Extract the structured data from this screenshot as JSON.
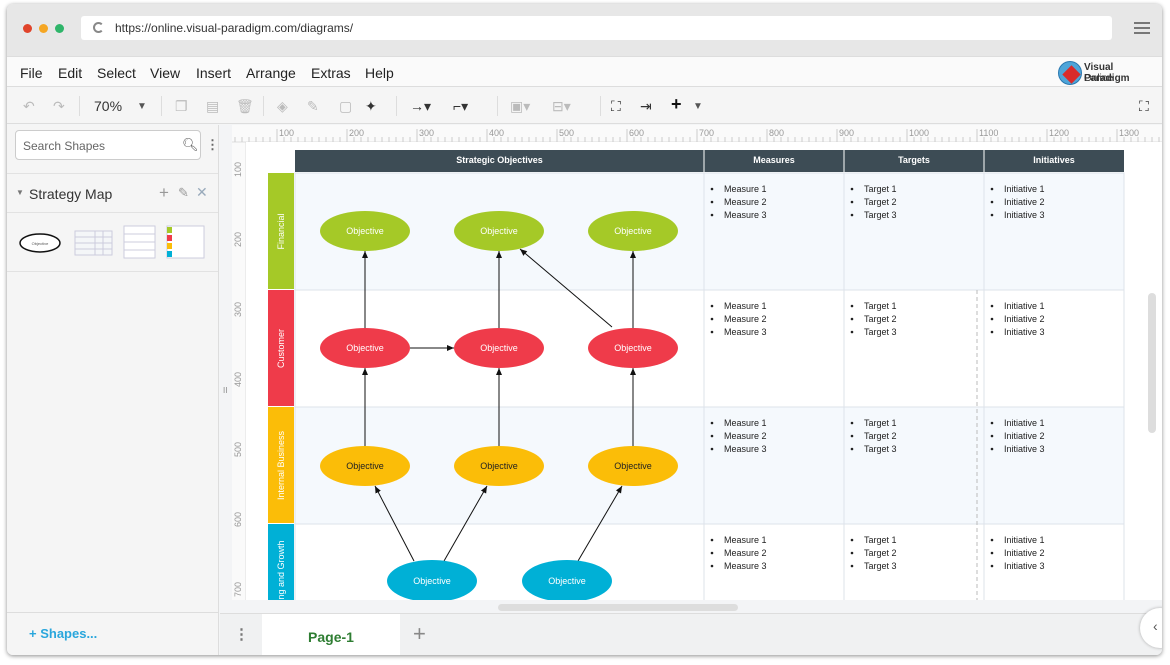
{
  "browser": {
    "url": "https://online.visual-paradigm.com/diagrams/"
  },
  "menu": {
    "items": [
      "File",
      "Edit",
      "Select",
      "View",
      "Insert",
      "Arrange",
      "Extras",
      "Help"
    ]
  },
  "logo": {
    "line1": "Visual Paradigm",
    "line2": "Online"
  },
  "toolbar": {
    "zoom": "70%"
  },
  "sidebar": {
    "search_placeholder": "Search Shapes",
    "section": "Strategy Map",
    "shapes_link": "+ Shapes...",
    "thumb_label": "Objective"
  },
  "pages": {
    "current": "Page-1"
  },
  "ruler": {
    "top": [
      "100",
      "200",
      "300",
      "400",
      "500",
      "600",
      "700",
      "800",
      "900",
      "1000",
      "1100",
      "1200",
      "1300"
    ],
    "left": [
      "100",
      "200",
      "300",
      "400",
      "500",
      "600",
      "700"
    ]
  },
  "diagram": {
    "headers": [
      "Strategic Objectives",
      "Measures",
      "Targets",
      "Initiatives"
    ],
    "rows": [
      {
        "label": "Financial",
        "color": "#a5c927",
        "objectives": [
          "Objective",
          "Objective",
          "Objective"
        ]
      },
      {
        "label": "Customer",
        "color": "#ef3b4a",
        "objectives": [
          "Objective",
          "Objective",
          "Objective"
        ]
      },
      {
        "label": "Internal Business",
        "color": "#fbbd08",
        "objectives": [
          "Objective",
          "Objective",
          "Objective"
        ]
      },
      {
        "label": "Learning and Growth",
        "color": "#00b0d6",
        "objectives": [
          "Objective",
          "Objective"
        ]
      }
    ],
    "measures": [
      "Measure 1",
      "Measure 2",
      "Measure 3"
    ],
    "targets": [
      "Target 1",
      "Target 2",
      "Target 3"
    ],
    "initiatives": [
      "Initiative 1",
      "Initiative 2",
      "Initiative 3"
    ],
    "header_color": "#3d4c55"
  }
}
